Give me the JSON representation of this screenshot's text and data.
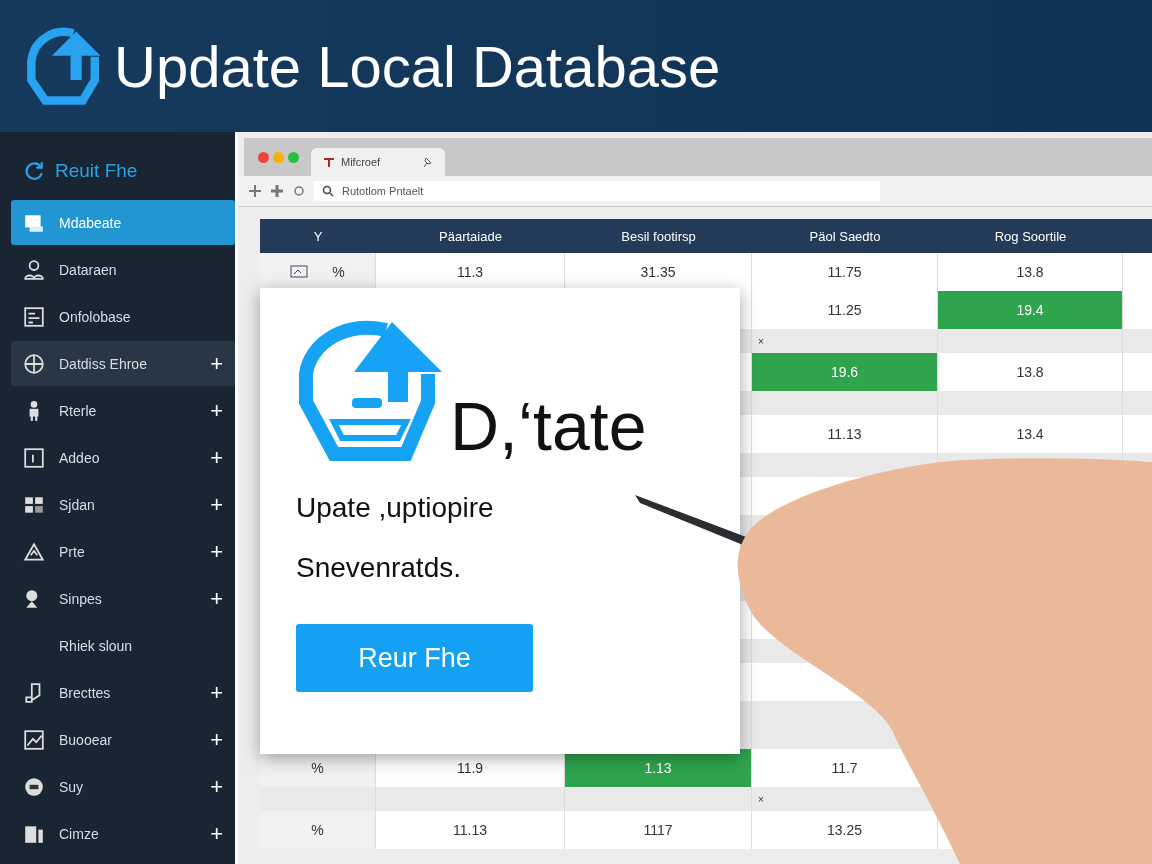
{
  "header": {
    "title": "Update Local Database"
  },
  "sidebar": {
    "brand": "Reuit Fhe",
    "items": [
      {
        "label": "Mdabeate",
        "selected": true,
        "highlighted": false
      },
      {
        "label": "Dataraen",
        "selected": false,
        "highlighted": false
      },
      {
        "label": "Onfolobase",
        "selected": false,
        "highlighted": false
      },
      {
        "label": "Datdiss Ehroe",
        "toggle": "+",
        "selected": false,
        "highlighted": true
      },
      {
        "label": "Rterle",
        "toggle": "+",
        "selected": false,
        "highlighted": false
      },
      {
        "label": "Addeo",
        "toggle": "+",
        "selected": false,
        "highlighted": false
      },
      {
        "label": "Sjdan",
        "toggle": "+",
        "selected": false,
        "highlighted": false
      },
      {
        "label": "Prte",
        "toggle": "+",
        "selected": false,
        "highlighted": false
      },
      {
        "label": "Sinpes",
        "toggle": "+",
        "selected": false,
        "highlighted": false
      },
      {
        "label": "Rhiek sloun",
        "selected": false,
        "highlighted": false
      },
      {
        "label": "Brecttes",
        "toggle": "+",
        "selected": false,
        "highlighted": false
      },
      {
        "label": "Buooear",
        "toggle": "+",
        "selected": false,
        "highlighted": false
      },
      {
        "label": "Suy",
        "toggle": "+",
        "selected": false,
        "highlighted": false
      },
      {
        "label": "Cimze",
        "toggle": "+",
        "selected": false,
        "highlighted": false
      }
    ]
  },
  "browser": {
    "tab": {
      "title": "Mifcroef"
    },
    "address": "Rutotlom Pntaelt"
  },
  "table": {
    "columns": [
      "Y",
      "Päartaiade",
      "Besil footirsp",
      "Päol Saedto",
      "Rog Soortile"
    ],
    "rows": [
      {
        "kind": "data",
        "icon": true,
        "cells": [
          {
            "text": "%",
            "highlighted": false
          },
          {
            "text": "11.3",
            "highlighted": false
          },
          {
            "text": "31.35",
            "highlighted": false
          },
          {
            "text": "11.75",
            "highlighted": false
          },
          {
            "text": "13.8",
            "highlighted": false
          }
        ]
      },
      {
        "kind": "data",
        "cells": [
          null,
          null,
          null,
          {
            "text": "11.25",
            "highlighted": false
          },
          {
            "text": "19.4",
            "highlighted": true
          }
        ]
      },
      {
        "kind": "gap",
        "marker": "×"
      },
      {
        "kind": "data",
        "cells": [
          null,
          null,
          null,
          {
            "text": "19.6",
            "highlighted": true
          },
          {
            "text": "13.8",
            "highlighted": false
          }
        ]
      },
      {
        "kind": "gap"
      },
      {
        "kind": "data",
        "cells": [
          null,
          null,
          null,
          {
            "text": "11.13",
            "highlighted": false
          },
          {
            "text": "13.4",
            "highlighted": false
          }
        ]
      },
      {
        "kind": "gap"
      },
      {
        "kind": "blank"
      },
      {
        "kind": "gap"
      },
      {
        "kind": "blank"
      },
      {
        "kind": "gap"
      },
      {
        "kind": "blank"
      },
      {
        "kind": "gap"
      },
      {
        "kind": "blank"
      },
      {
        "kind": "gap"
      },
      {
        "kind": "gap"
      },
      {
        "kind": "data",
        "cells": [
          {
            "text": "%",
            "highlighted": false
          },
          {
            "text": "11.9",
            "highlighted": false
          },
          {
            "text": "1.13",
            "highlighted": true
          },
          {
            "text": "11.7",
            "highlighted": false
          },
          null
        ]
      },
      {
        "kind": "gap",
        "marker": "×"
      },
      {
        "kind": "data",
        "cells": [
          {
            "text": "%",
            "highlighted": false
          },
          {
            "text": "11.13",
            "highlighted": false
          },
          {
            "text": "1117",
            "highlighted": false
          },
          {
            "text": "13.25",
            "highlighted": false
          },
          null
        ]
      }
    ]
  },
  "card": {
    "title": "D,‘tate",
    "lines": [
      "Upate ,uptiopire",
      "Snevenratds."
    ],
    "button": "Reur Fhe"
  }
}
